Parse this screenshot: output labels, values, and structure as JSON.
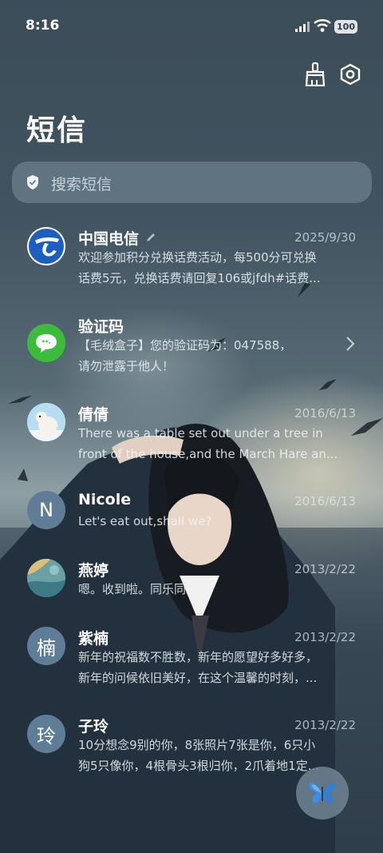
{
  "status": {
    "time": "8:16",
    "battery": "100"
  },
  "header": {
    "title": "短信"
  },
  "search": {
    "placeholder": "搜索短信"
  },
  "conversations": [
    {
      "name": "中国电信",
      "date": "2025/9/30",
      "line1": "欢迎参加积分兑换话费活动，每500分可兑换",
      "line2": "话费5元，兑换话费请回复106或jfdh#话费..."
    },
    {
      "name": "验证码",
      "date": "",
      "line1": "【毛绒盒子】您的验证码为：047588，",
      "line2": "请勿泄露于他人！"
    },
    {
      "name": "倩倩",
      "date": "2016/6/13",
      "line1": "There was a table set out under a tree in",
      "line2": "front of the house,and the March Hare an..."
    },
    {
      "name": "Nicole",
      "date": "2016/6/13",
      "line1": "Let's eat out,shall we?",
      "line2": "",
      "avatar_letter": "N"
    },
    {
      "name": "燕婷",
      "date": "2013/2/22",
      "line1": "嗯。收到啦。同乐同乐。",
      "line2": ""
    },
    {
      "name": "紫楠",
      "date": "2013/2/22",
      "line1": "新年的祝福数不胜数，新年的愿望好多好多，",
      "line2": "新年的问候依旧美好，在这个温馨的时刻，...",
      "avatar_letter": "楠"
    },
    {
      "name": "子玲",
      "date": "2013/2/22",
      "line1": "10分想念9别的你，8张照片7张是你，6只小",
      "line2": "狗5只像你，4根骨头3根归你，2爪着地1定...",
      "avatar_letter": "玲"
    }
  ],
  "icons": {
    "clean": "broom-icon",
    "settings": "settings-icon",
    "search": "search-icon",
    "edit": "pencil-icon",
    "chevron": "chevron-right-icon",
    "fab": "butterfly-icon"
  },
  "colors": {
    "telecom_blue": "#1d5fbe",
    "sms_green": "#3dbb3d",
    "letter_avatar": "#5f7d96"
  }
}
